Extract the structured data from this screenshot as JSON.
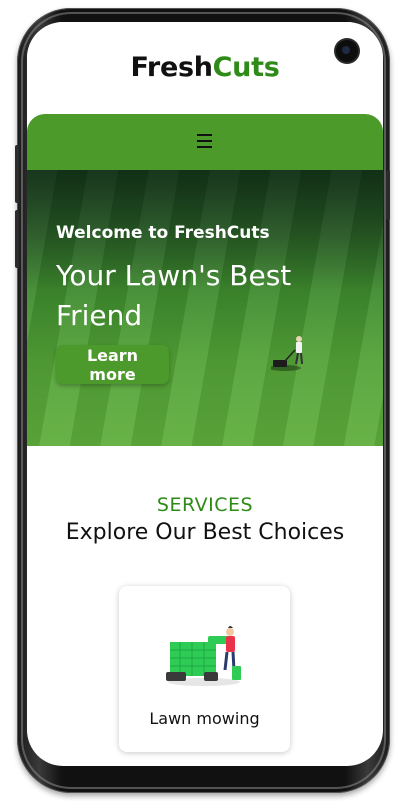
{
  "brand": {
    "name_part1": "Fresh",
    "name_part2": "Cuts"
  },
  "nav": {
    "menu_icon": "hamburger-menu-icon"
  },
  "hero": {
    "subtitle": "Welcome to FreshCuts",
    "title": "Your Lawn's Best Friend",
    "cta_label": "Learn more"
  },
  "services": {
    "label": "SERVICES",
    "title": "Explore Our Best Choices",
    "items": [
      {
        "name": "Lawn mowing",
        "icon": "lawn-mowing-illustration"
      }
    ]
  },
  "colors": {
    "brand_green": "#2e8b18",
    "nav_green": "#4c9a2a",
    "button_green": "#4d9a2c"
  }
}
